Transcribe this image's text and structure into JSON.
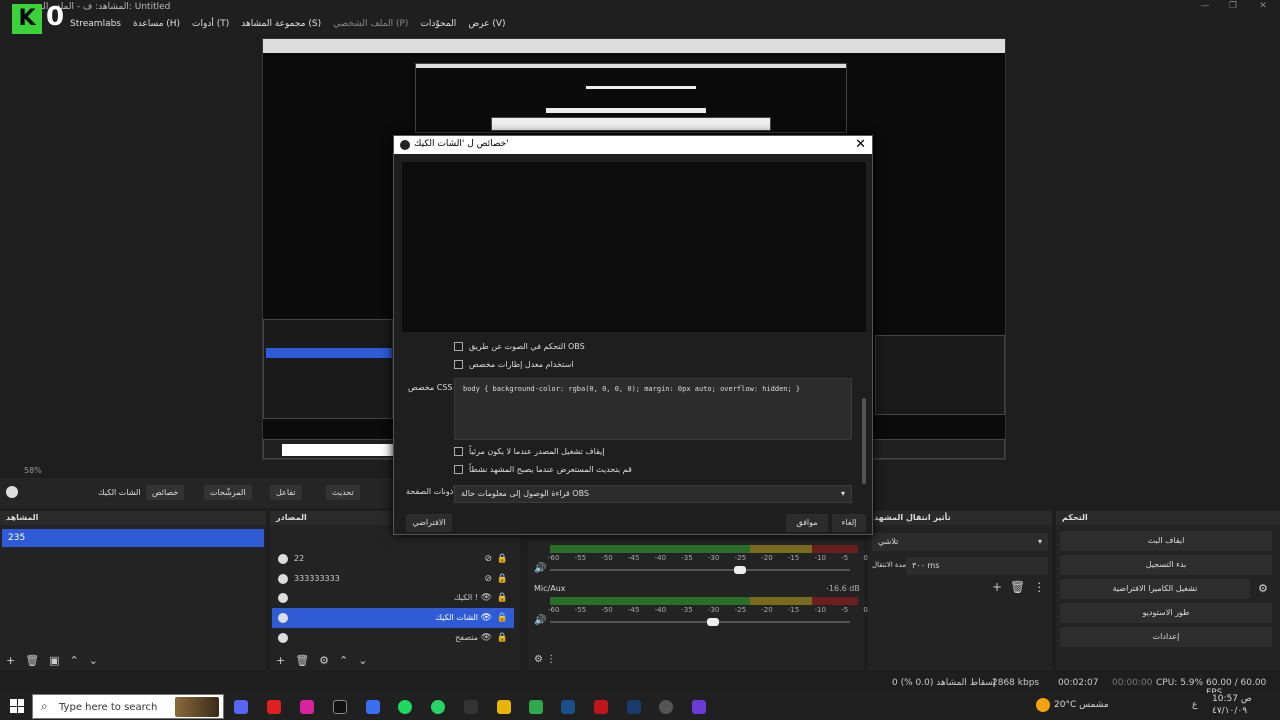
{
  "window": {
    "title": "المشاهد: ف - الملف الشخصي: Untitled",
    "logo_k": "K",
    "logo_o": "0",
    "min": "—",
    "max": "❐",
    "close": "✕"
  },
  "menu": [
    "عرض (V)",
    "المحوّدات",
    "الملف الشخصي (P)",
    "مجموعة المشاهد (S)",
    "أدوات (T)",
    "مساعدة (H)",
    "Streamlabs"
  ],
  "zoom": "58%",
  "toolbar": {
    "source_name": "الشات الكيك",
    "properties": "خصائص",
    "filters": "المرشّحات",
    "interact": "تفاعل",
    "refresh": "تحديث"
  },
  "docks": {
    "scenes_title": "المشاهد",
    "sources_title": "المصادر",
    "transitions_title": "تأثير انتقال المشهد",
    "controls_title": "التحكم"
  },
  "scenes": [
    "235"
  ],
  "sources": [
    "22",
    "333333333",
    "الكيك !",
    "الشات الكيك",
    "متصفح"
  ],
  "audio": {
    "mic_label": "Mic/Aux",
    "mic_db": "-16.6 dB",
    "ticks": [
      "-60",
      "-55",
      "-50",
      "-45",
      "-40",
      "-35",
      "-30",
      "-25",
      "-20",
      "-15",
      "-10",
      "-5",
      "0"
    ]
  },
  "transitions": {
    "type": "تلاشي",
    "duration_label": "مدة الانتقال",
    "duration_value": "٣٠٠ ms"
  },
  "controls": [
    "ايقاف البث",
    "بدء التسجيل",
    "تشغيل الكاميرا الافتراضية",
    "طور الاستوديو",
    "إعدادات"
  ],
  "status": {
    "dropped": "إسقاط المشاهد (0.0 %) 0",
    "kbps": "2868 kbps",
    "stream_time": "00:02:07",
    "rec_time": "00:00:00",
    "cpu": "CPU: 5.9%",
    "fps": "60.00 / 60.00 FPS"
  },
  "dialog": {
    "title": "خصائص ل 'الشات الكيك'",
    "close": "✕",
    "check_audio": "التحكم في الصوت عن طريق OBS",
    "check_fps": "استخدام معدل إطارات مخصص",
    "css_label": "مخصص CSS",
    "css_value": "body { background-color: rgba(0, 0, 0, 0); margin: 0px auto; overflow: hidden; }",
    "check_shutdown": "إيقاف تشغيل المصدر عندما لا يكون مرئياً",
    "check_refresh": "قم بتحديث المستعرض عندما يصبح المشهد نشطاً",
    "page_perm_label": "أذونات الصفحة",
    "page_perm_value": "قراءة الوصول إلى معلومات حالة OBS",
    "defaults": "الافتراضي",
    "ok": "موافق",
    "cancel": "إلغاء"
  },
  "taskbar": {
    "search_placeholder": "Type here to search",
    "weather": "20°C  مشمس",
    "time": "10:57 ص",
    "date": "٤٧/١٠/٠٩",
    "lang": "ع"
  }
}
